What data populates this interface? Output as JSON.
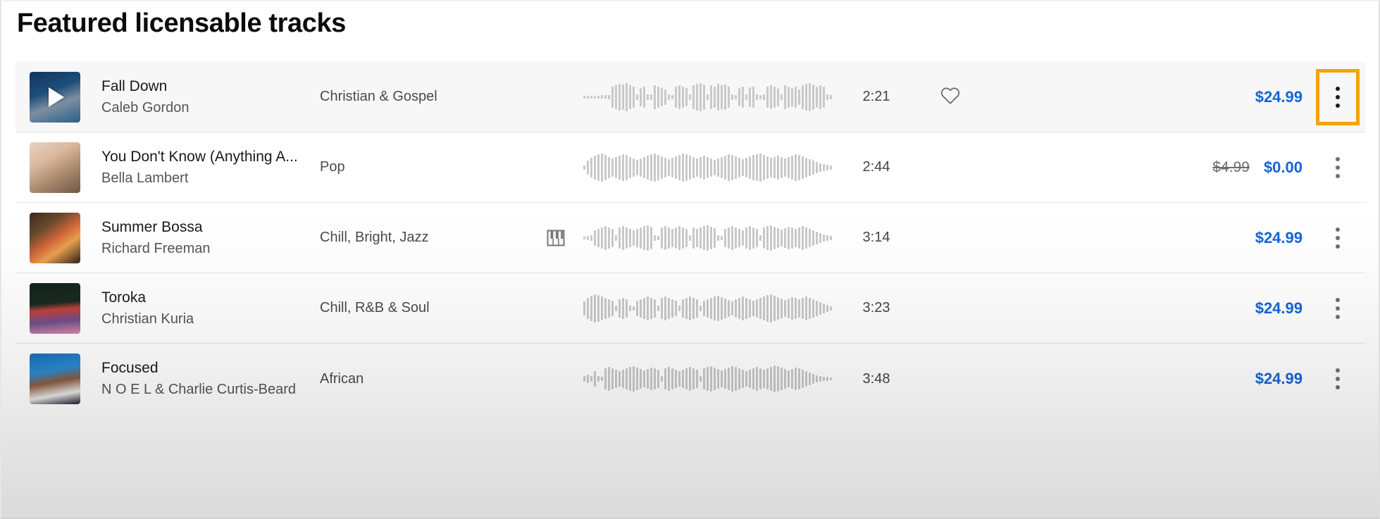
{
  "header": {
    "title": "Featured licensable tracks"
  },
  "colors": {
    "price_blue": "#1464d8",
    "focus_orange": "#f5a306",
    "row_hover_bg": "#f7f7f7",
    "waveform_gray": "#c9c9c9"
  },
  "icons": {
    "play": "play-icon",
    "heart": "heart-icon",
    "piano": "piano-icon",
    "kebab": "more-options-icon"
  },
  "tracks": [
    {
      "title": "Fall Down",
      "artist": "Caleb Gordon",
      "genre": "Christian & Gospel",
      "duration": "2:21",
      "price": "$24.99",
      "original_price": "",
      "has_instrument_badge": false,
      "has_favorite": true,
      "hovered": true,
      "menu_focused": true,
      "thumb_css": "linear-gradient(160deg,#10355c 0%,#1d4f7c 38%,#7e8ea0 62%,#2a5f8a 100%)",
      "wave": [
        4,
        4,
        4,
        4,
        4,
        5,
        5,
        6,
        30,
        34,
        38,
        36,
        40,
        34,
        30,
        8,
        26,
        30,
        8,
        8,
        34,
        30,
        26,
        22,
        8,
        6,
        30,
        34,
        30,
        26,
        8,
        34,
        38,
        40,
        36,
        8,
        34,
        30,
        38,
        34,
        36,
        30,
        8,
        6,
        26,
        30,
        8,
        28,
        30,
        8,
        6,
        8,
        30,
        34,
        30,
        26,
        8,
        34,
        30,
        26,
        30,
        22,
        34,
        38,
        40,
        36,
        30,
        34,
        30,
        8,
        6
      ]
    },
    {
      "title": "You Don't Know (Anything A...",
      "artist": "Bella Lambert",
      "genre": "Pop",
      "duration": "2:44",
      "price": "$0.00",
      "original_price": "$4.99",
      "has_instrument_badge": false,
      "has_favorite": false,
      "hovered": false,
      "menu_focused": false,
      "thumb_css": "linear-gradient(150deg,#e8d4c4 0%,#d9b79c 35%,#b08f72 60%,#6d5744 100%)",
      "wave": [
        6,
        20,
        28,
        34,
        38,
        40,
        36,
        30,
        26,
        30,
        34,
        38,
        36,
        30,
        26,
        22,
        26,
        30,
        34,
        38,
        40,
        36,
        32,
        28,
        24,
        28,
        32,
        36,
        40,
        38,
        34,
        30,
        26,
        30,
        34,
        30,
        26,
        22,
        26,
        30,
        34,
        38,
        36,
        32,
        28,
        24,
        28,
        32,
        36,
        38,
        40,
        36,
        32,
        28,
        30,
        34,
        30,
        26,
        30,
        34,
        38,
        36,
        32,
        28,
        24,
        20,
        16,
        12,
        10,
        8,
        6
      ]
    },
    {
      "title": "Summer Bossa",
      "artist": "Richard Freeman",
      "genre": "Chill, Bright, Jazz",
      "duration": "3:14",
      "price": "$24.99",
      "original_price": "",
      "has_instrument_badge": true,
      "has_favorite": false,
      "hovered": false,
      "menu_focused": false,
      "thumb_css": "linear-gradient(145deg,#3a2a1e 0%,#6b4a2e 30%,#d4683a 52%,#e8a050 68%,#2f2116 100%)",
      "wave": [
        4,
        6,
        8,
        22,
        26,
        30,
        34,
        30,
        26,
        8,
        30,
        34,
        30,
        26,
        22,
        26,
        30,
        34,
        36,
        32,
        8,
        6,
        30,
        34,
        30,
        26,
        30,
        34,
        30,
        26,
        8,
        30,
        26,
        30,
        34,
        36,
        32,
        28,
        8,
        6,
        26,
        30,
        34,
        30,
        26,
        22,
        30,
        34,
        30,
        26,
        8,
        30,
        34,
        36,
        32,
        28,
        24,
        28,
        32,
        30,
        26,
        30,
        34,
        30,
        26,
        22,
        18,
        14,
        10,
        8,
        6
      ]
    },
    {
      "title": "Toroka",
      "artist": "Christian Kuria",
      "genre": "Chill, R&B & Soul",
      "duration": "3:23",
      "price": "$24.99",
      "original_price": "",
      "has_instrument_badge": false,
      "has_favorite": false,
      "hovered": false,
      "menu_focused": false,
      "thumb_css": "linear-gradient(175deg,#14221c 0%,#1a2a22 40%,#c0413a 52%,#6f4f8a 74%,#d98aa8 100%)",
      "wave": [
        20,
        30,
        36,
        40,
        38,
        34,
        30,
        26,
        22,
        8,
        26,
        30,
        26,
        8,
        6,
        22,
        26,
        30,
        34,
        30,
        26,
        8,
        30,
        34,
        30,
        26,
        22,
        8,
        26,
        30,
        34,
        30,
        26,
        8,
        22,
        26,
        30,
        34,
        36,
        32,
        28,
        24,
        20,
        26,
        30,
        34,
        30,
        26,
        22,
        26,
        30,
        34,
        38,
        40,
        36,
        32,
        28,
        24,
        28,
        32,
        30,
        26,
        30,
        34,
        30,
        26,
        22,
        18,
        14,
        10,
        6
      ]
    },
    {
      "title": "Focused",
      "artist": "N O E L & Charlie Curtis-Beard",
      "genre": "African",
      "duration": "3:48",
      "price": "$24.99",
      "original_price": "",
      "has_instrument_badge": false,
      "has_favorite": false,
      "hovered": false,
      "menu_focused": false,
      "thumb_css": "linear-gradient(170deg,#1a6fb5 0%,#2b8ad0 35%,#8a5a3e 55%,#e8e8e8 78%,#1d1d2a 100%)",
      "wave": [
        8,
        12,
        8,
        22,
        8,
        6,
        30,
        34,
        30,
        26,
        22,
        26,
        30,
        34,
        36,
        32,
        28,
        24,
        28,
        32,
        30,
        26,
        8,
        30,
        34,
        30,
        26,
        22,
        26,
        30,
        34,
        30,
        26,
        8,
        30,
        34,
        36,
        32,
        28,
        24,
        28,
        32,
        36,
        34,
        30,
        26,
        22,
        26,
        30,
        34,
        30,
        26,
        30,
        34,
        38,
        36,
        32,
        28,
        24,
        28,
        32,
        30,
        26,
        22,
        18,
        14,
        10,
        8,
        6,
        6,
        4
      ]
    }
  ]
}
